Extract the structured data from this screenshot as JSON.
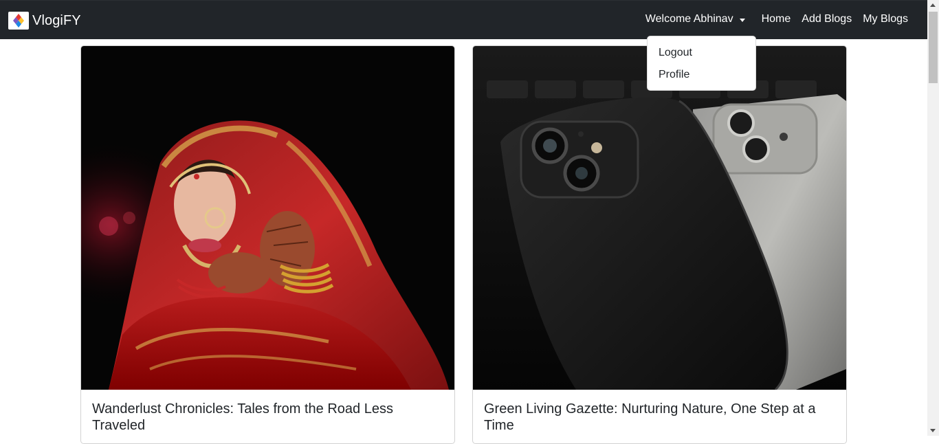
{
  "navbar": {
    "brand": "VlogiFY",
    "welcome": "Welcome Abhinav",
    "links": [
      "Home",
      "Add Blogs",
      "My Blogs"
    ]
  },
  "dropdown": {
    "items": [
      "Logout",
      "Profile"
    ]
  },
  "cards": [
    {
      "title": "Wanderlust Chronicles: Tales from the Road Less Traveled",
      "image": "bride-portrait-image"
    },
    {
      "title": "Green Living Gazette: Nurturing Nature, One Step at a Time",
      "image": "smartphones-image"
    }
  ],
  "colors": {
    "navbar_bg": "#212529",
    "text": "#212529"
  }
}
